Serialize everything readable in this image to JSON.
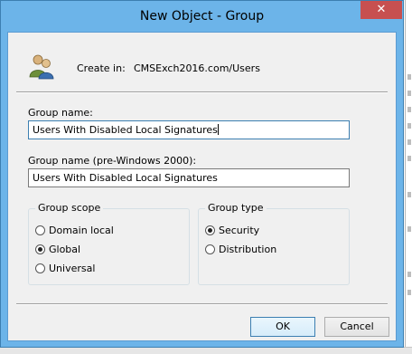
{
  "window": {
    "title": "New Object - Group",
    "close_glyph": "✕"
  },
  "header": {
    "create_in_label": "Create in:",
    "create_in_path": "CMSExch2016.com/Users",
    "icon": "users-group-icon"
  },
  "group_name": {
    "label": "Group name:",
    "value": "Users With Disabled Local Signatures"
  },
  "group_name_pre2000": {
    "label": "Group name (pre-Windows 2000):",
    "value": "Users With Disabled Local Signatures"
  },
  "group_scope": {
    "label": "Group scope",
    "options": [
      "Domain local",
      "Global",
      "Universal"
    ],
    "selected": "Global"
  },
  "group_type": {
    "label": "Group type",
    "options": [
      "Security",
      "Distribution"
    ],
    "selected": "Security"
  },
  "buttons": {
    "ok": "OK",
    "cancel": "Cancel"
  },
  "colors": {
    "title_bar": "#6cb4e9",
    "close_button": "#c75050",
    "client": "#f0f0f0"
  }
}
